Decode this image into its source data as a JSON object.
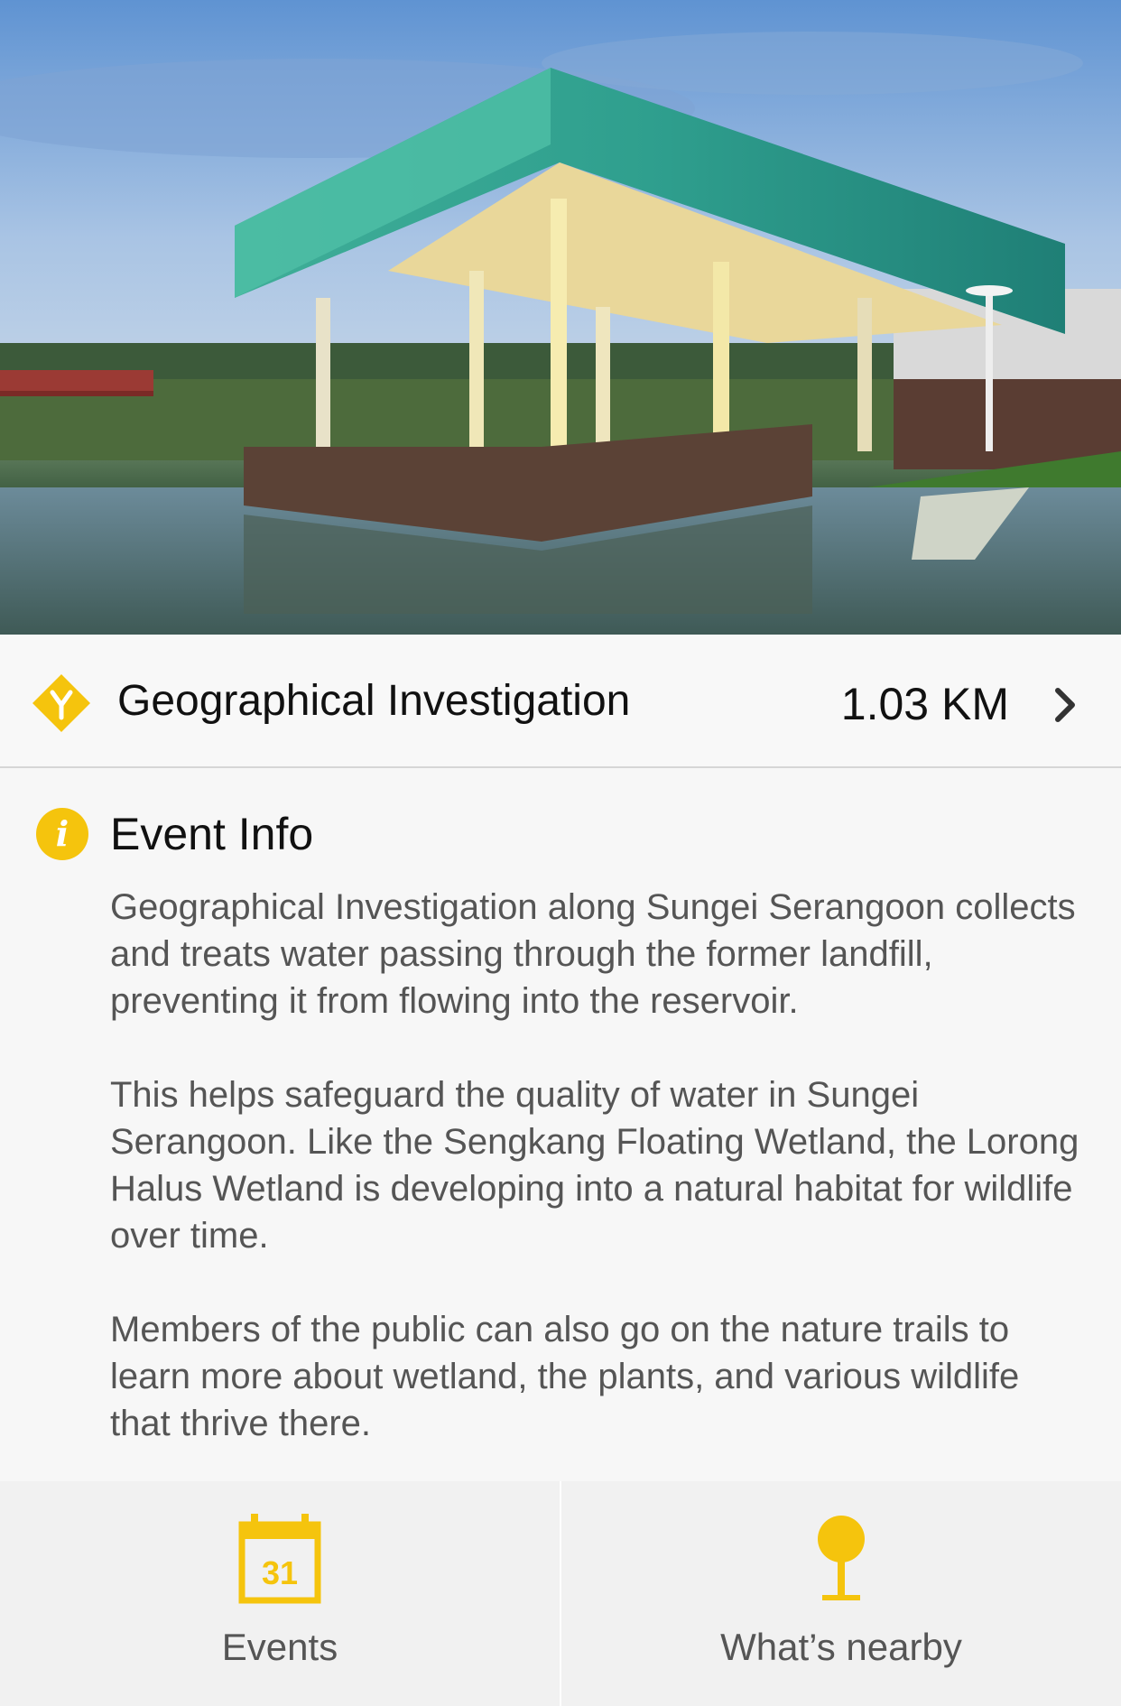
{
  "hero": {
    "image_description_icon": "wetland-pavilion-photo"
  },
  "place": {
    "title": "Geographical Investigation",
    "distance": "1.03 KM",
    "direction_icon": "directions-icon",
    "chevron_icon": "chevron-right-icon"
  },
  "info": {
    "heading": "Event Info",
    "icon": "info-icon",
    "icon_glyph": "i",
    "paragraphs": [
      "Geographical Investigation along Sungei Serangoon collects and treats water passing through the former landfill, preventing it from flowing into the reservoir.",
      "This helps safeguard the quality of water in Sungei Serangoon. Like the Sengkang Floating Wetland, the Lorong Halus Wetland is developing into a natural habitat for wildlife over time.",
      "Members of the public can also go on the nature trails to learn more about wetland, the plants, and various wildlife that thrive there."
    ]
  },
  "tabs": [
    {
      "label": "Events",
      "icon": "calendar-icon",
      "icon_text": "31"
    },
    {
      "label": "What’s nearby",
      "icon": "pin-icon"
    }
  ],
  "colors": {
    "accent": "#f5c40d",
    "text_primary": "#111111",
    "text_secondary": "#555555",
    "background": "#f7f7f7"
  }
}
